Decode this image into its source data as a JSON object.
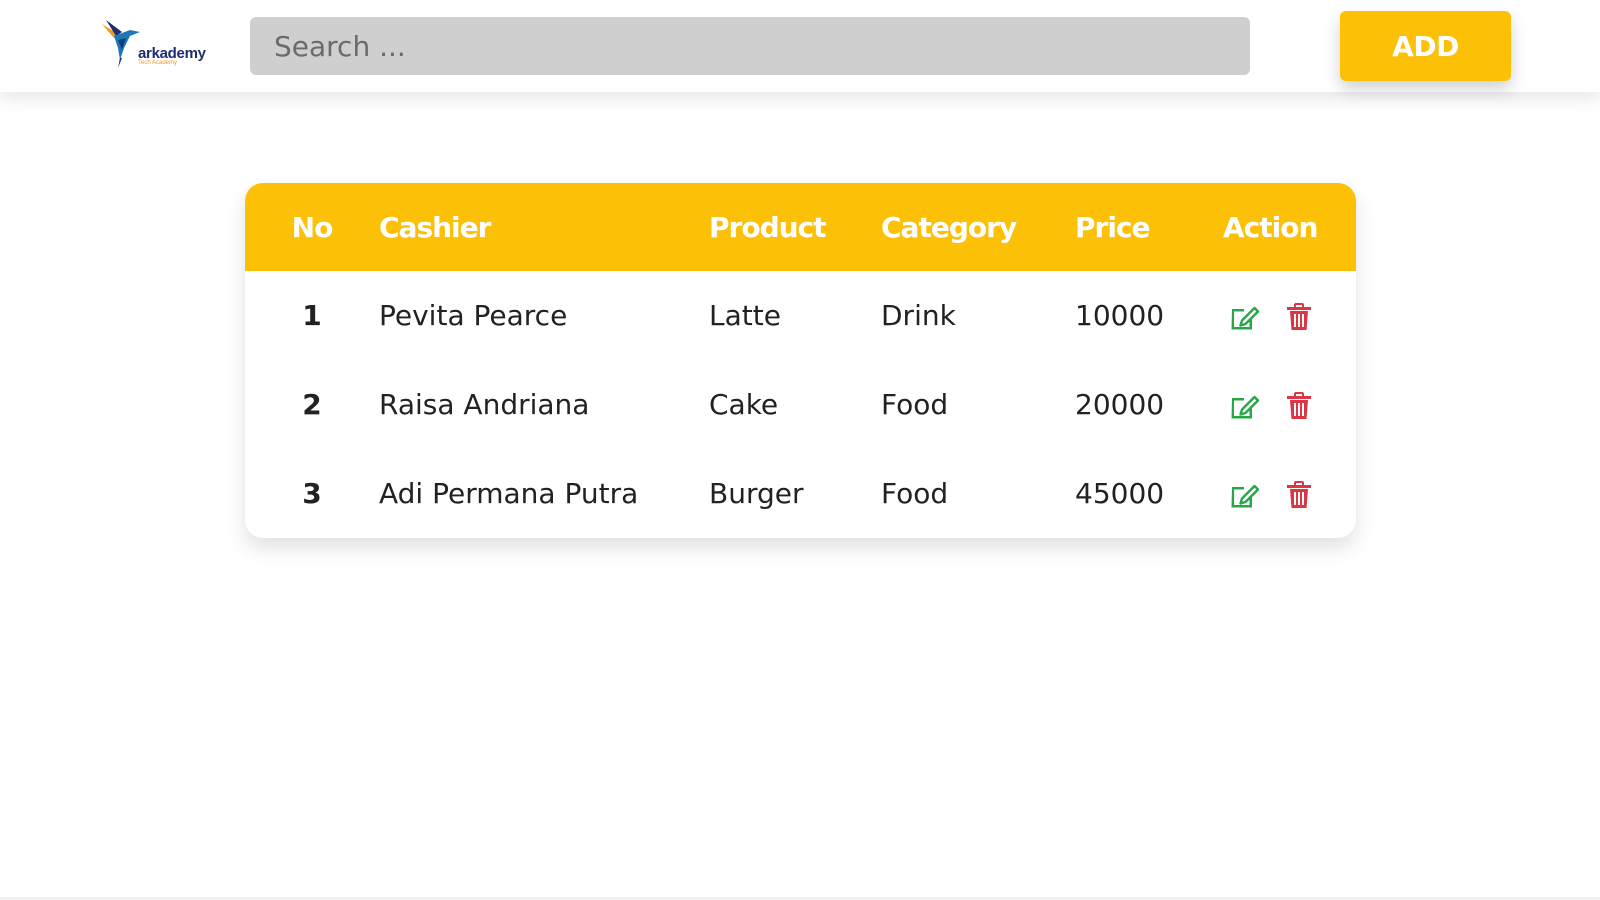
{
  "header": {
    "logo": {
      "name": "arkademy",
      "tagline": "Tech Academy"
    },
    "search": {
      "placeholder": "Search ...",
      "value": ""
    },
    "add_label": "ADD"
  },
  "table": {
    "columns": [
      "No",
      "Cashier",
      "Product",
      "Category",
      "Price",
      "Action"
    ],
    "rows": [
      {
        "no": "1",
        "cashier": "Pevita Pearce",
        "product": "Latte",
        "category": "Drink",
        "price": "10000"
      },
      {
        "no": "2",
        "cashier": "Raisa Andriana",
        "product": "Cake",
        "category": "Food",
        "price": "20000"
      },
      {
        "no": "3",
        "cashier": "Adi Permana Putra",
        "product": "Burger",
        "category": "Food",
        "price": "45000"
      }
    ],
    "row_actions": [
      {
        "icon": "edit-icon",
        "color": "#28a745"
      },
      {
        "icon": "trash-icon",
        "color": "#dc3545"
      }
    ]
  },
  "colors": {
    "accent": "#fcc106",
    "search_bg": "#cfcfcf",
    "edit": "#28a745",
    "delete": "#dc3545",
    "logo_text": "#1d2c6e",
    "logo_sub": "#f29a17"
  }
}
